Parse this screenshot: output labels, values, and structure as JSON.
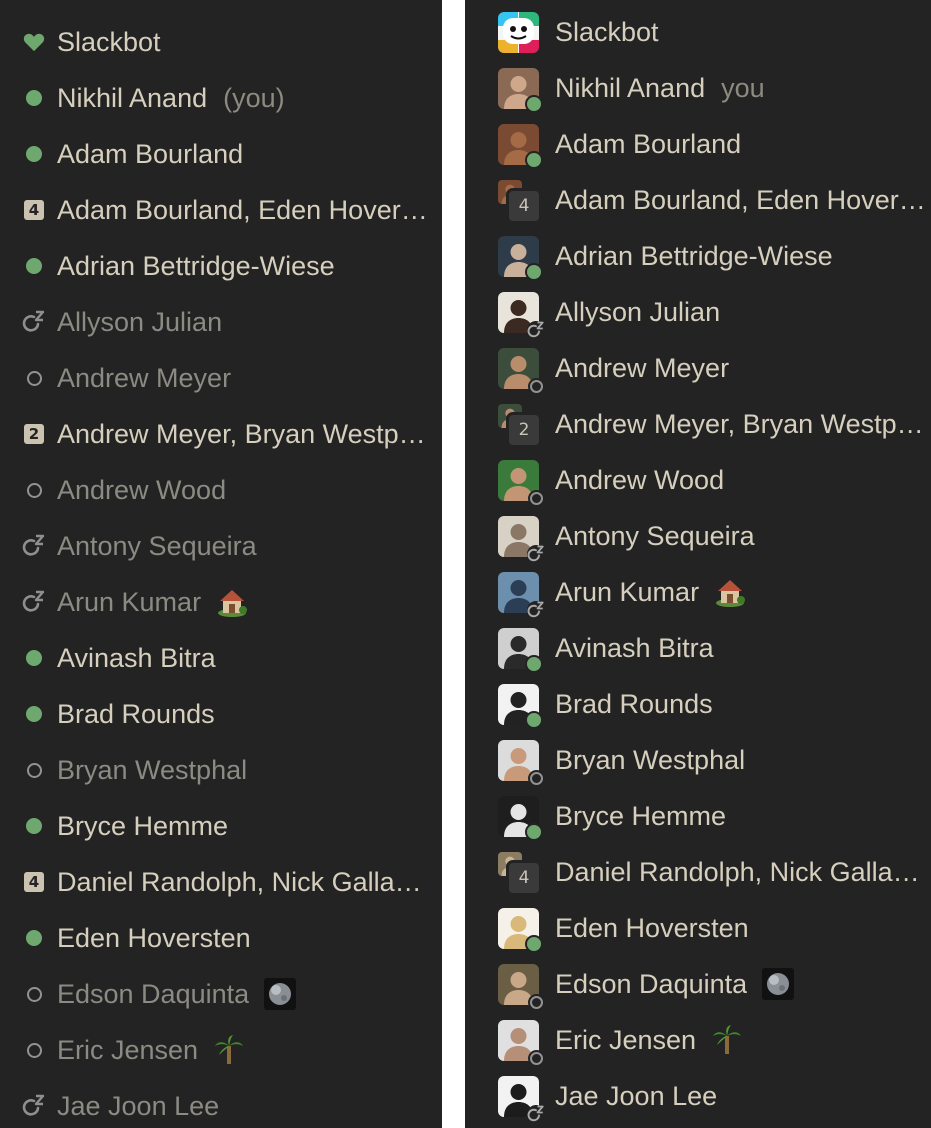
{
  "left_list": [
    {
      "label": "Slackbot",
      "status": "heart",
      "tone": "bright"
    },
    {
      "label": "Nikhil Anand",
      "you": "(you)",
      "status": "active",
      "tone": "bright"
    },
    {
      "label": "Adam Bourland",
      "status": "active",
      "tone": "bright"
    },
    {
      "label": "Adam Bourland, Eden Hoversten",
      "status": "count",
      "count": "4",
      "tone": "bright"
    },
    {
      "label": "Adrian Bettridge-Wiese",
      "status": "active",
      "tone": "bright"
    },
    {
      "label": "Allyson Julian",
      "status": "snooze",
      "tone": "dim"
    },
    {
      "label": "Andrew Meyer",
      "status": "away",
      "tone": "dim"
    },
    {
      "label": "Andrew Meyer, Bryan Westphal",
      "status": "count",
      "count": "2",
      "tone": "bright"
    },
    {
      "label": "Andrew Wood",
      "status": "away",
      "tone": "dim"
    },
    {
      "label": "Antony Sequeira",
      "status": "snooze",
      "tone": "dim"
    },
    {
      "label": "Arun Kumar",
      "status": "snooze",
      "tone": "dim",
      "emoji": "house-icon"
    },
    {
      "label": "Avinash Bitra",
      "status": "active",
      "tone": "bright"
    },
    {
      "label": "Brad Rounds",
      "status": "active",
      "tone": "bright"
    },
    {
      "label": "Bryan Westphal",
      "status": "away",
      "tone": "dim"
    },
    {
      "label": "Bryce Hemme",
      "status": "active",
      "tone": "bright"
    },
    {
      "label": "Daniel Randolph, Nick Gallagher",
      "status": "count",
      "count": "4",
      "tone": "bright"
    },
    {
      "label": "Eden Hoversten",
      "status": "active",
      "tone": "bright"
    },
    {
      "label": "Edson Daquinta",
      "status": "away",
      "tone": "dim",
      "emoji": "moon-icon"
    },
    {
      "label": "Eric Jensen",
      "status": "away",
      "tone": "dim",
      "emoji": "palm-tree-icon"
    },
    {
      "label": "Jae Joon Lee",
      "status": "snooze",
      "tone": "dim"
    }
  ],
  "right_list": [
    {
      "label": "Slackbot",
      "status": "bot",
      "avatar": "slackbot"
    },
    {
      "label": "Nikhil Anand",
      "you": "you",
      "status": "active",
      "avatar": "a1"
    },
    {
      "label": "Adam Bourland",
      "status": "active",
      "avatar": "a2"
    },
    {
      "label": "Adam Bourland, Eden Hoversten",
      "status": "group",
      "count": "4",
      "avatar": "a2"
    },
    {
      "label": "Adrian Bettridge-Wiese",
      "status": "active",
      "avatar": "a3"
    },
    {
      "label": "Allyson Julian",
      "status": "snooze",
      "avatar": "a4"
    },
    {
      "label": "Andrew Meyer",
      "status": "away",
      "avatar": "a5"
    },
    {
      "label": "Andrew Meyer, Bryan Westphal",
      "status": "group",
      "count": "2",
      "avatar": "a5"
    },
    {
      "label": "Andrew Wood",
      "status": "away",
      "avatar": "a6"
    },
    {
      "label": "Antony Sequeira",
      "status": "snooze",
      "avatar": "a7"
    },
    {
      "label": "Arun Kumar",
      "status": "snooze",
      "avatar": "a8",
      "emoji": "house-icon"
    },
    {
      "label": "Avinash Bitra",
      "status": "active",
      "avatar": "a9"
    },
    {
      "label": "Brad Rounds",
      "status": "active",
      "avatar": "a10"
    },
    {
      "label": "Bryan Westphal",
      "status": "away",
      "avatar": "a11"
    },
    {
      "label": "Bryce Hemme",
      "status": "active",
      "avatar": "a12"
    },
    {
      "label": "Daniel Randolph, Nick Gallagher",
      "status": "group",
      "count": "4",
      "avatar": "a13"
    },
    {
      "label": "Eden Hoversten",
      "status": "active",
      "avatar": "a14"
    },
    {
      "label": "Edson Daquinta",
      "status": "away",
      "avatar": "a15",
      "emoji": "moon-icon"
    },
    {
      "label": "Eric Jensen",
      "status": "away",
      "avatar": "a16",
      "emoji": "palm-tree-icon"
    },
    {
      "label": "Jae Joon Lee",
      "status": "snooze",
      "avatar": "a17"
    }
  ],
  "avatar_colors": {
    "a1": [
      "#8a6a55",
      "#cfa88c"
    ],
    "a2": [
      "#7b4a33",
      "#a56a46"
    ],
    "a3": [
      "#2e3b48",
      "#c9b09a"
    ],
    "a4": [
      "#e8e4dc",
      "#3b2a22"
    ],
    "a5": [
      "#3d4d3b",
      "#b98d6c"
    ],
    "a6": [
      "#3a7a3a",
      "#c29575"
    ],
    "a7": [
      "#d8d2c6",
      "#8a7765"
    ],
    "a8": [
      "#6d8fae",
      "#2c3e55"
    ],
    "a9": [
      "#cfcfcf",
      "#2a2a2a"
    ],
    "a10": [
      "#f2f2f2",
      "#222222"
    ],
    "a11": [
      "#dcdcdc",
      "#c99a7a"
    ],
    "a12": [
      "#1e1e1e",
      "#e5e5e5"
    ],
    "a13": [
      "#8b7d62",
      "#c7b596"
    ],
    "a14": [
      "#f5f1e8",
      "#d9b97a"
    ],
    "a15": [
      "#6a5e45",
      "#c9a889"
    ],
    "a16": [
      "#e0e0e0",
      "#b58f77"
    ],
    "a17": [
      "#f2f2f2",
      "#1c1c1c"
    ]
  },
  "colors": {
    "panel_bg": "#232323",
    "active": "#6fa86f",
    "away": "#929292",
    "text_bright": "#d6cfbd",
    "text_dim": "#8b8a83",
    "badge_bg": "#cbc3b0"
  }
}
